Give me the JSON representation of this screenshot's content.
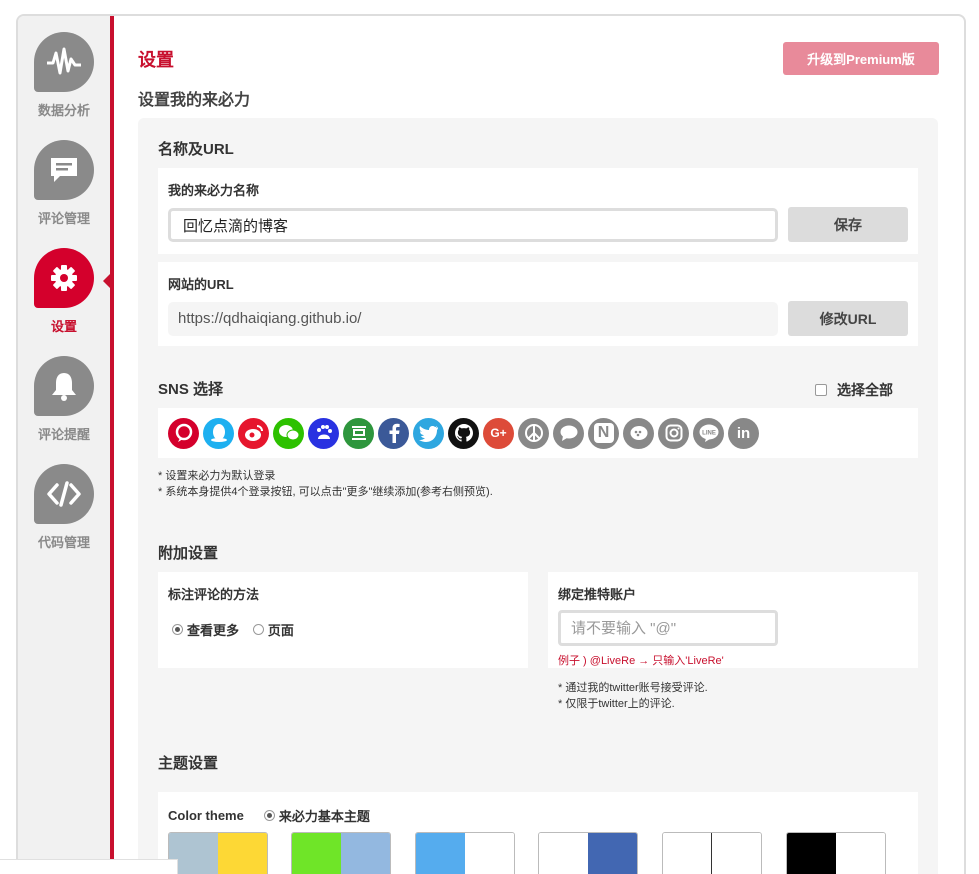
{
  "sidebar": {
    "items": [
      {
        "label": "数据分析",
        "icon": "waveform-icon"
      },
      {
        "label": "评论管理",
        "icon": "comment-icon"
      },
      {
        "label": "设置",
        "icon": "gear-icon",
        "active": true
      },
      {
        "label": "评论提醒",
        "icon": "bell-icon"
      },
      {
        "label": "代码管理",
        "icon": "code-icon"
      }
    ]
  },
  "header": {
    "title": "设置",
    "premium_button": "升级到Premium版",
    "subtitle": "设置我的来必力"
  },
  "name_url": {
    "section_title": "名称及URL",
    "name_label": "我的来必力名称",
    "name_value": "回忆点滴的博客",
    "save_button": "保存",
    "url_label": "网站的URL",
    "url_value": "https://qdhaiqiang.github.io/",
    "change_url_button": "修改URL"
  },
  "sns": {
    "section_title": "SNS 选择",
    "select_all_label": "选择全部",
    "icons": [
      {
        "name": "livere-icon",
        "color": "#d4002c"
      },
      {
        "name": "qq-icon",
        "color": "#1eb0f0"
      },
      {
        "name": "weibo-icon",
        "color": "#e6162d"
      },
      {
        "name": "wechat-icon",
        "color": "#2dc100"
      },
      {
        "name": "baidu-icon",
        "color": "#2932e1"
      },
      {
        "name": "douban-icon",
        "color": "#2e963d"
      },
      {
        "name": "facebook-icon",
        "color": "#3b5998"
      },
      {
        "name": "twitter-icon",
        "color": "#2ea7e0"
      },
      {
        "name": "github-icon",
        "color": "#111111"
      },
      {
        "name": "google-plus-icon",
        "color": "#dd4b39"
      },
      {
        "name": "peace-icon",
        "color": "#888888"
      },
      {
        "name": "chat-icon",
        "color": "#888888"
      },
      {
        "name": "naver-icon",
        "color": "#888888"
      },
      {
        "name": "kakao-icon",
        "color": "#888888"
      },
      {
        "name": "instagram-icon",
        "color": "#888888"
      },
      {
        "name": "line-icon",
        "color": "#888888"
      },
      {
        "name": "linkedin-icon",
        "color": "#888888"
      }
    ],
    "notes": [
      "* 设置来必力为默认登录",
      "* 系统本身提供4个登录按钮, 可以点击\"更多\"继续添加(参考右侧预览)."
    ]
  },
  "extra": {
    "section_title": "附加设置",
    "mark_label": "标注评论的方法",
    "mark_options": [
      "查看更多",
      "页面"
    ],
    "twitter_label": "绑定推特账户",
    "twitter_placeholder": "请不要输入 \"@\"",
    "twitter_example": "例子 ) @LiveRe → 只输入'LiveRe'",
    "twitter_notes": [
      "* 通过我的twitter账号接受评论.",
      "* 仅限于twitter上的评论."
    ]
  },
  "theme": {
    "section_title": "主题设置",
    "color_theme_label": "Color theme",
    "color_theme_option": "来必力基本主题",
    "swatches": [
      [
        "#aec4d2",
        "#fdd835"
      ],
      [
        "#6fe528",
        "#93b8e0"
      ],
      [
        "#55acee",
        "#ffffff"
      ],
      [
        "#ffffff",
        "#4267b2"
      ],
      [
        "#ffffff",
        "#ffffff"
      ],
      [
        "#000000",
        "#ffffff"
      ]
    ]
  }
}
